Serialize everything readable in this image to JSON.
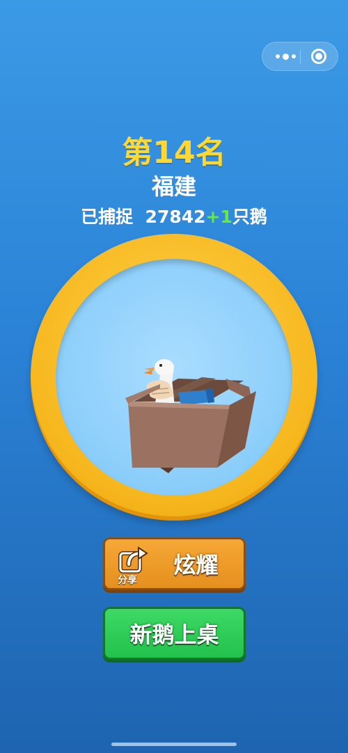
{
  "capsule": {
    "more_icon": "more-dots-icon",
    "close_icon": "close-circle-icon"
  },
  "result": {
    "rank": "第14名",
    "province": "福建",
    "caught_prefix": "已捕捉",
    "caught_count": "27842",
    "caught_plus": "+1",
    "caught_unit": "只鹅"
  },
  "medallion": {
    "image": "goose-in-box-illustration"
  },
  "buttons": {
    "share_label": "炫耀",
    "share_sublabel": "分享",
    "share_icon": "share-export-icon",
    "new_goose_label": "新鹅上桌"
  },
  "colors": {
    "rank_yellow": "#ffd733",
    "plus_green": "#6bea3c",
    "share_orange": "#f0a02e",
    "new_green": "#2bc955"
  }
}
